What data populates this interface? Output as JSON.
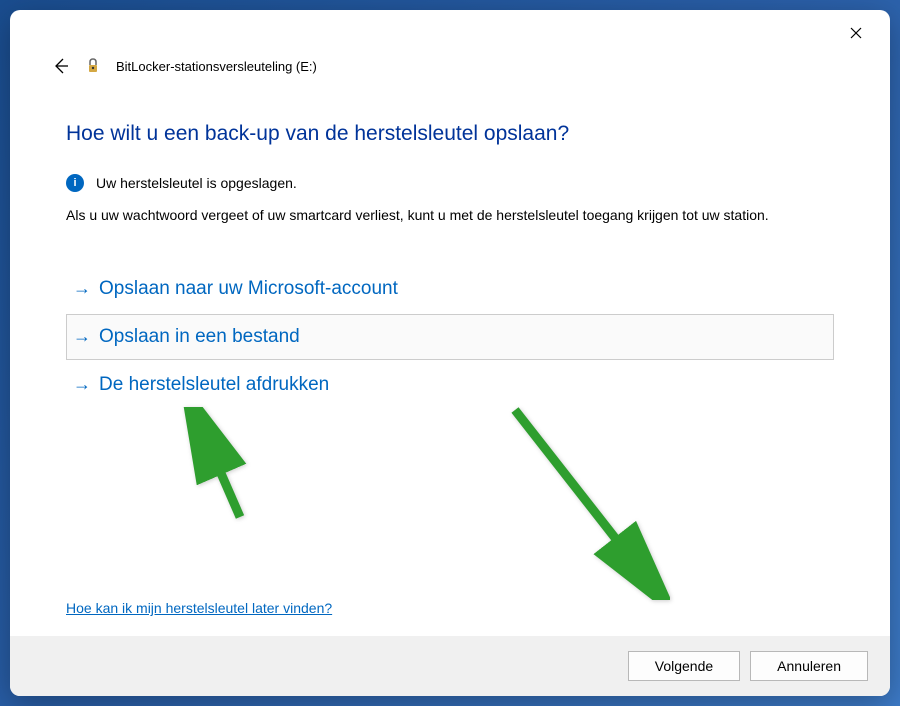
{
  "window": {
    "app_title": "BitLocker-stationsversleuteling (E:)"
  },
  "content": {
    "heading": "Hoe wilt u een back-up van de herstelsleutel opslaan?",
    "info_text": "Uw herstelsleutel is opgeslagen.",
    "description": "Als u uw wachtwoord vergeet of uw smartcard verliest, kunt u met de herstelsleutel toegang krijgen tot uw station.",
    "options": [
      {
        "label": "Opslaan naar uw Microsoft-account",
        "selected": false
      },
      {
        "label": "Opslaan in een bestand",
        "selected": true
      },
      {
        "label": "De herstelsleutel afdrukken",
        "selected": false
      }
    ],
    "help_link": "Hoe kan ik mijn herstelsleutel later vinden?"
  },
  "footer": {
    "next_label": "Volgende",
    "cancel_label": "Annuleren"
  },
  "colors": {
    "accent": "#0067c0",
    "annotation": "#2e9e2e"
  }
}
